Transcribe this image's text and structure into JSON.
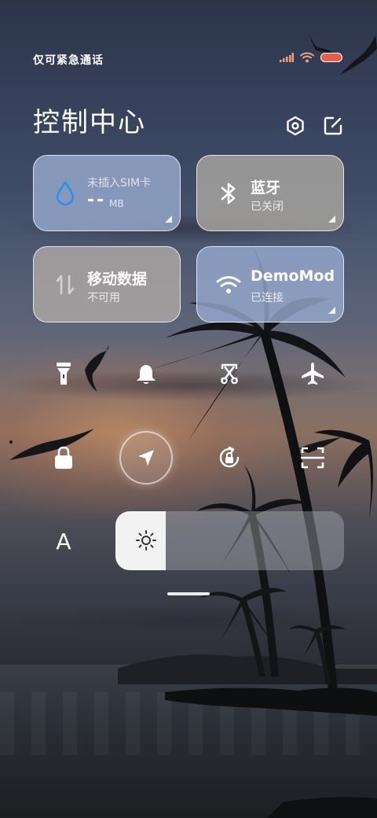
{
  "status_bar": {
    "carrier_text": "仅可紧急通话",
    "battery_color": "#e85d4a"
  },
  "header": {
    "title": "控制中心",
    "settings_icon": "gear-hex-icon",
    "edit_icon": "edit-icon"
  },
  "tiles": {
    "data_usage": {
      "label": "未插入SIM卡",
      "value": "--",
      "unit": "MB",
      "icon": "water-drop-icon",
      "icon_color": "#2d8fe8"
    },
    "bluetooth": {
      "title": "蓝牙",
      "status": "已关闭",
      "icon": "bluetooth-icon"
    },
    "mobile_data": {
      "title": "移动数据",
      "status": "不可用",
      "icon": "data-arrows-icon"
    },
    "wifi": {
      "title": "DemoMod",
      "status": "已连接",
      "icon": "wifi-icon"
    }
  },
  "quick_toggles": [
    {
      "name": "flashlight-toggle",
      "icon": "flashlight-icon",
      "active": false
    },
    {
      "name": "ringer-toggle",
      "icon": "bell-icon",
      "active": false
    },
    {
      "name": "screenshot-toggle",
      "icon": "scissors-icon",
      "active": false
    },
    {
      "name": "airplane-toggle",
      "icon": "airplane-icon",
      "active": false
    },
    {
      "name": "lock-screen-toggle",
      "icon": "lock-icon",
      "active": false
    },
    {
      "name": "location-toggle",
      "icon": "location-arrow-icon",
      "active": true
    },
    {
      "name": "rotation-lock-toggle",
      "icon": "rotation-lock-icon",
      "active": false
    },
    {
      "name": "scanner-toggle",
      "icon": "scan-icon",
      "active": false
    }
  ],
  "font_toggle": {
    "label": "A"
  },
  "brightness": {
    "level_fraction": 0.22,
    "icon": "sun-icon"
  },
  "colors": {
    "accent_blue": "#2d8fe8",
    "tile_blue": "#96a8cd",
    "tile_gray": "#aaa6a0"
  }
}
